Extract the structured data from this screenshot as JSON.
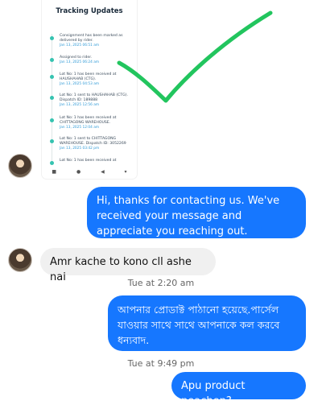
{
  "tracking_card": {
    "title": "Tracking Updates",
    "updates": [
      {
        "text": "Consignment has been marked as delivered by rider.",
        "date": "Jan 13, 2025 06:51 am"
      },
      {
        "text": "Assigned to rider.",
        "date": "Jan 13, 2025 06:24 am"
      },
      {
        "text": "Lot No: 1 has been received at HAUSHAHAB (CTG).",
        "date": "Jan 13, 2025 04:53 am"
      },
      {
        "text": "Lot No: 1 sent to HAUSHAHAB (CTG). Dispatch ID: 189888",
        "date": "Jan 13, 2025 12:56 am"
      },
      {
        "text": "Lot No: 1 has been received at CHITTAGONG WAREHOUSE.",
        "date": "Jan 13, 2025 12:04 am"
      },
      {
        "text": "Lot No: 1 sent to CHITTAGONG WAREHOUSE. Dispatch ID: 3052269",
        "date": "Jan 13, 2025 03:42 pm"
      },
      {
        "text": "Lot No: 1 has been received at",
        "date": ""
      }
    ],
    "nav": [
      "■",
      "●",
      "◀",
      "▾"
    ]
  },
  "messages": {
    "m1": "Hi, thanks for contacting us. We've received your message and appreciate you reaching out.",
    "m2": "Amr kache to kono cll ashe nai",
    "ts1": "Tue at 2:20 am",
    "m3": "আপনার প্রোডাক্ট পাঠানো হয়েছে.পার্সেল যাওয়ার সাথে সাথে আপনাকে কল করবে ধন্যবাদ.",
    "ts2": "Tue at 9:49 pm",
    "m4": "Apu product peachen?"
  },
  "colors": {
    "outgoing_bubble": "#1677ff",
    "incoming_bubble": "#f0f0f0",
    "check_mark": "#22c55e"
  }
}
